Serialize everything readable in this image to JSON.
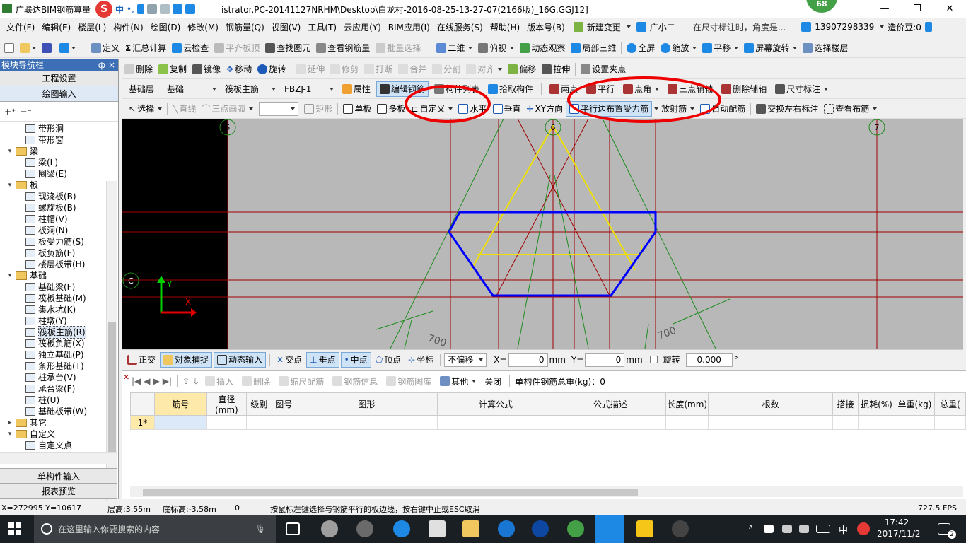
{
  "window": {
    "app_title": "广联达BIM钢筋算量",
    "path_title": "istrator.PC-20141127NRHM\\Desktop\\白龙村-2016-08-25-13-27-07(2166版)_16G.GGJ12]",
    "badge": "68",
    "minimize": "—",
    "maximize": "❐",
    "close": "✕"
  },
  "ime": {
    "logo": "S",
    "mode": "中",
    "punct": "•,"
  },
  "menu": {
    "items": [
      "文件(F)",
      "编辑(E)",
      "楼层(L)",
      "构件(N)",
      "绘图(D)",
      "修改(M)",
      "钢筋量(Q)",
      "视图(V)",
      "工具(T)",
      "云应用(Y)",
      "BIM应用(I)",
      "在线服务(S)",
      "帮助(H)",
      "版本号(B)"
    ],
    "new_change": "新建变更",
    "assistant": "广小二",
    "hint": "在尺寸标注时，角度是...",
    "phone": "13907298339",
    "beans": "造价豆:0"
  },
  "toolbar1": {
    "define": "定义",
    "sum": "汇总计算",
    "cloud_check": "云检查",
    "flush_top": "平齐板顶",
    "find_elem": "查找图元",
    "view_rebar": "查看钢筋量",
    "batch_select": "批量选择",
    "view_2d": "二维",
    "top_view": "俯视",
    "dynamic_view": "动态观察",
    "local_3d": "局部三维",
    "fullscreen": "全屏",
    "zoom": "缩放",
    "pan": "平移",
    "screen_rotate": "屏幕旋转",
    "select_floor": "选择楼层"
  },
  "toolbar2": {
    "delete": "删除",
    "copy": "复制",
    "mirror": "镜像",
    "move": "移动",
    "rotate": "旋转",
    "extend": "延伸",
    "trim": "修剪",
    "break": "打断",
    "merge": "合并",
    "split": "分割",
    "align": "对齐",
    "offset": "偏移",
    "stretch": "拉伸",
    "set_grip": "设置夹点"
  },
  "toolbar3": {
    "floor": "基础层",
    "category": "基础",
    "element_type": "筏板主筋",
    "element": "FBZJ-1",
    "properties": "属性",
    "edit_rebar": "编辑钢筋",
    "elem_list": "构件列表",
    "pick": "拾取构件",
    "two_points": "两点",
    "parallel": "平行",
    "point_angle": "点角",
    "three_point_aux": "三点辅轴",
    "delete_aux": "删除辅轴",
    "dim": "尺寸标注"
  },
  "toolbar4": {
    "select": "选择",
    "line": "直线",
    "arc": "三点画弧",
    "rect": "矩形",
    "single_slab": "单板",
    "multi_slab": "多板",
    "custom": "自定义",
    "horizontal": "水平",
    "vertical": "垂直",
    "xy_dir": "XY方向",
    "parallel_edge": "平行边布置受力筋",
    "radial": "放射筋",
    "auto_config": "自动配筋",
    "swap_label": "交换左右标注",
    "view_layout": "查看布筋"
  },
  "left_panel": {
    "header": "模块导航栏",
    "project_settings": "工程设置",
    "drawing_input": "绘图输入",
    "tree": [
      {
        "label": "带形洞",
        "level": 2,
        "type": "item"
      },
      {
        "label": "带形窗",
        "level": 2,
        "type": "item"
      },
      {
        "label": "梁",
        "level": 1,
        "type": "folder"
      },
      {
        "label": "梁(L)",
        "level": 2,
        "type": "item"
      },
      {
        "label": "圈梁(E)",
        "level": 2,
        "type": "item"
      },
      {
        "label": "板",
        "level": 1,
        "type": "folder"
      },
      {
        "label": "现浇板(B)",
        "level": 2,
        "type": "item"
      },
      {
        "label": "螺旋板(B)",
        "level": 2,
        "type": "item"
      },
      {
        "label": "柱帽(V)",
        "level": 2,
        "type": "item"
      },
      {
        "label": "板洞(N)",
        "level": 2,
        "type": "item"
      },
      {
        "label": "板受力筋(S)",
        "level": 2,
        "type": "item"
      },
      {
        "label": "板负筋(F)",
        "level": 2,
        "type": "item"
      },
      {
        "label": "楼层板带(H)",
        "level": 2,
        "type": "item"
      },
      {
        "label": "基础",
        "level": 1,
        "type": "folder"
      },
      {
        "label": "基础梁(F)",
        "level": 2,
        "type": "item"
      },
      {
        "label": "筏板基础(M)",
        "level": 2,
        "type": "item"
      },
      {
        "label": "集水坑(K)",
        "level": 2,
        "type": "item"
      },
      {
        "label": "柱墩(Y)",
        "level": 2,
        "type": "item"
      },
      {
        "label": "筏板主筋(R)",
        "level": 2,
        "type": "item",
        "selected": true
      },
      {
        "label": "筏板负筋(X)",
        "level": 2,
        "type": "item"
      },
      {
        "label": "独立基础(P)",
        "level": 2,
        "type": "item"
      },
      {
        "label": "条形基础(T)",
        "level": 2,
        "type": "item"
      },
      {
        "label": "桩承台(V)",
        "level": 2,
        "type": "item"
      },
      {
        "label": "承台梁(F)",
        "level": 2,
        "type": "item"
      },
      {
        "label": "桩(U)",
        "level": 2,
        "type": "item"
      },
      {
        "label": "基础板带(W)",
        "level": 2,
        "type": "item"
      },
      {
        "label": "其它",
        "level": 1,
        "type": "folder_collapsed"
      },
      {
        "label": "自定义",
        "level": 1,
        "type": "folder"
      },
      {
        "label": "自定义点",
        "level": 2,
        "type": "item"
      }
    ],
    "single_input": "单构件输入",
    "report": "报表预览"
  },
  "canvas": {
    "axis_labels": [
      "5",
      "6",
      "7",
      "C"
    ],
    "dim_labels": [
      "700",
      "700"
    ],
    "y_axis": "Y",
    "x_axis": "X"
  },
  "snap": {
    "ortho": "正交",
    "object_snap": "对象捕捉",
    "dynamic_input": "动态输入",
    "intersection": "交点",
    "perpendicular": "垂点",
    "midpoint": "中点",
    "vertex": "顶点",
    "coordinate": "坐标",
    "offset_mode": "不偏移",
    "x_label": "X=",
    "x_value": "0",
    "y_label": "Y=",
    "y_value": "0",
    "unit": "mm",
    "rotate": "旋转",
    "rotate_value": "0.000",
    "degree": "°"
  },
  "rebar_panel": {
    "insert": "插入",
    "delete": "删除",
    "scale": "缩尺配筋",
    "rebar_info": "钢筋信息",
    "rebar_lib": "钢筋图库",
    "other": "其他",
    "close": "关闭",
    "total": "单构件钢筋总重(kg)：0",
    "columns": [
      "筋号",
      "直径(mm)",
      "级别",
      "图号",
      "图形",
      "计算公式",
      "公式描述",
      "长度(mm)",
      "根数",
      "搭接",
      "损耗(%)",
      "单重(kg)",
      "总重("
    ],
    "row_marker": "1*"
  },
  "status": {
    "coords": "X=272995 Y=10617",
    "floor_height": "层高:3.55m",
    "bottom_height": "底标高:-3.58m",
    "zero": "0",
    "message": "按鼠标左键选择与钢筋平行的板边线，按右键中止或ESC取消",
    "fps": "727.5 FPS"
  },
  "taskbar": {
    "search_placeholder": "在这里输入你要搜索的内容",
    "time": "17:42",
    "date": "2017/11/2",
    "lang": "中",
    "notify": "2"
  },
  "colors": {
    "canvas_bg": "#b8b8b8",
    "axis_red": "#c00000",
    "blue_poly": "#0000ff",
    "yellow_tri": "#f0e000",
    "green_rebar": "#1e8c1e",
    "annotation_red": "#e00000"
  }
}
